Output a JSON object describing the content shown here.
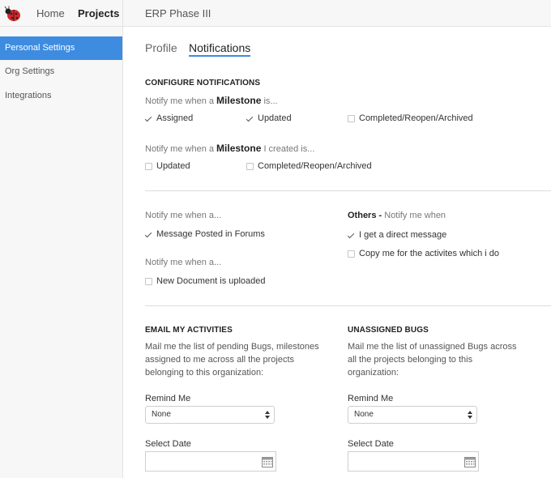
{
  "header": {
    "nav_home": "Home",
    "nav_projects": "Projects",
    "project_name": "ERP Phase III"
  },
  "sidebar": {
    "items": [
      {
        "label": "Personal Settings",
        "active": true
      },
      {
        "label": "Org Settings",
        "active": false
      },
      {
        "label": "Integrations",
        "active": false
      }
    ]
  },
  "tabs": {
    "profile": "Profile",
    "notifications": "Notifications"
  },
  "configure": {
    "title": "CONFIGURE NOTIFICATIONS",
    "milestone_hint_prefix": "Notify me when a ",
    "milestone_word": "Milestone",
    "milestone_hint_suffix": " is...",
    "assigned": "Assigned",
    "updated": "Updated",
    "completed": "Completed/Reopen/Archived",
    "created_hint_prefix": "Notify me when a ",
    "created_word": "Milestone",
    "created_hint_suffix": " I created is...",
    "created_updated": "Updated",
    "created_completed": "Completed/Reopen/Archived"
  },
  "activities": {
    "forum_hint": "Notify me when a...",
    "forum_label": "Message Posted in Forums",
    "doc_hint": "Notify me when a...",
    "doc_label": "New Document is uploaded",
    "others_title": "Others -",
    "others_hint": " Notify me when",
    "direct_label": "I get a direct message",
    "copy_label": "Copy me for the activites which i do"
  },
  "email": {
    "title": "EMAIL MY ACTIVITIES",
    "description": "Mail me the list of pending Bugs, milestones assigned to me across all the projects belonging to this organization:",
    "remind_label": "Remind Me",
    "remind_value": "None",
    "date_label": "Select Date"
  },
  "unassigned": {
    "title": "UNASSIGNED BUGS",
    "description": "Mail me the list of unassigned Bugs across all the projects belonging to this organization:",
    "remind_label": "Remind Me",
    "remind_value": "None",
    "date_label": "Select Date"
  },
  "checkbox_states": {
    "assigned": true,
    "updated": true,
    "completed": false,
    "created_updated": false,
    "created_completed": false,
    "forum": true,
    "doc": false,
    "direct": true,
    "copy": false
  },
  "colors": {
    "accent": "#3d8ce0",
    "sidebar_bg": "#f7f7f7",
    "logo_red": "#d8262b"
  },
  "icons": {
    "logo": "ladybug-logo-icon",
    "select": "select-arrows-icon",
    "calendar": "calendar-icon"
  }
}
